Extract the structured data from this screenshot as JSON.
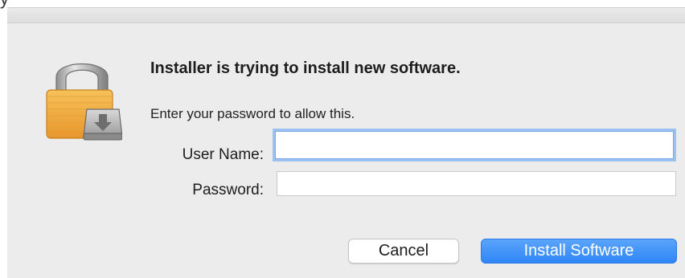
{
  "window": {
    "title_fragment": "y"
  },
  "dialog": {
    "headline": "Installer is trying to install new software.",
    "message": "Enter your password to allow this.",
    "fields": {
      "user_name_label": "User Name:",
      "user_name_value": "",
      "password_label": "Password:",
      "password_value": ""
    },
    "buttons": {
      "cancel_label": "Cancel",
      "install_label": "Install Software"
    },
    "icon": "padlock-with-installer-icon"
  },
  "colors": {
    "accent": "#2f86f6",
    "focus_ring": "#9cc2f2",
    "dialog_background": "#ececec",
    "lock_body": "#f0a73a"
  }
}
